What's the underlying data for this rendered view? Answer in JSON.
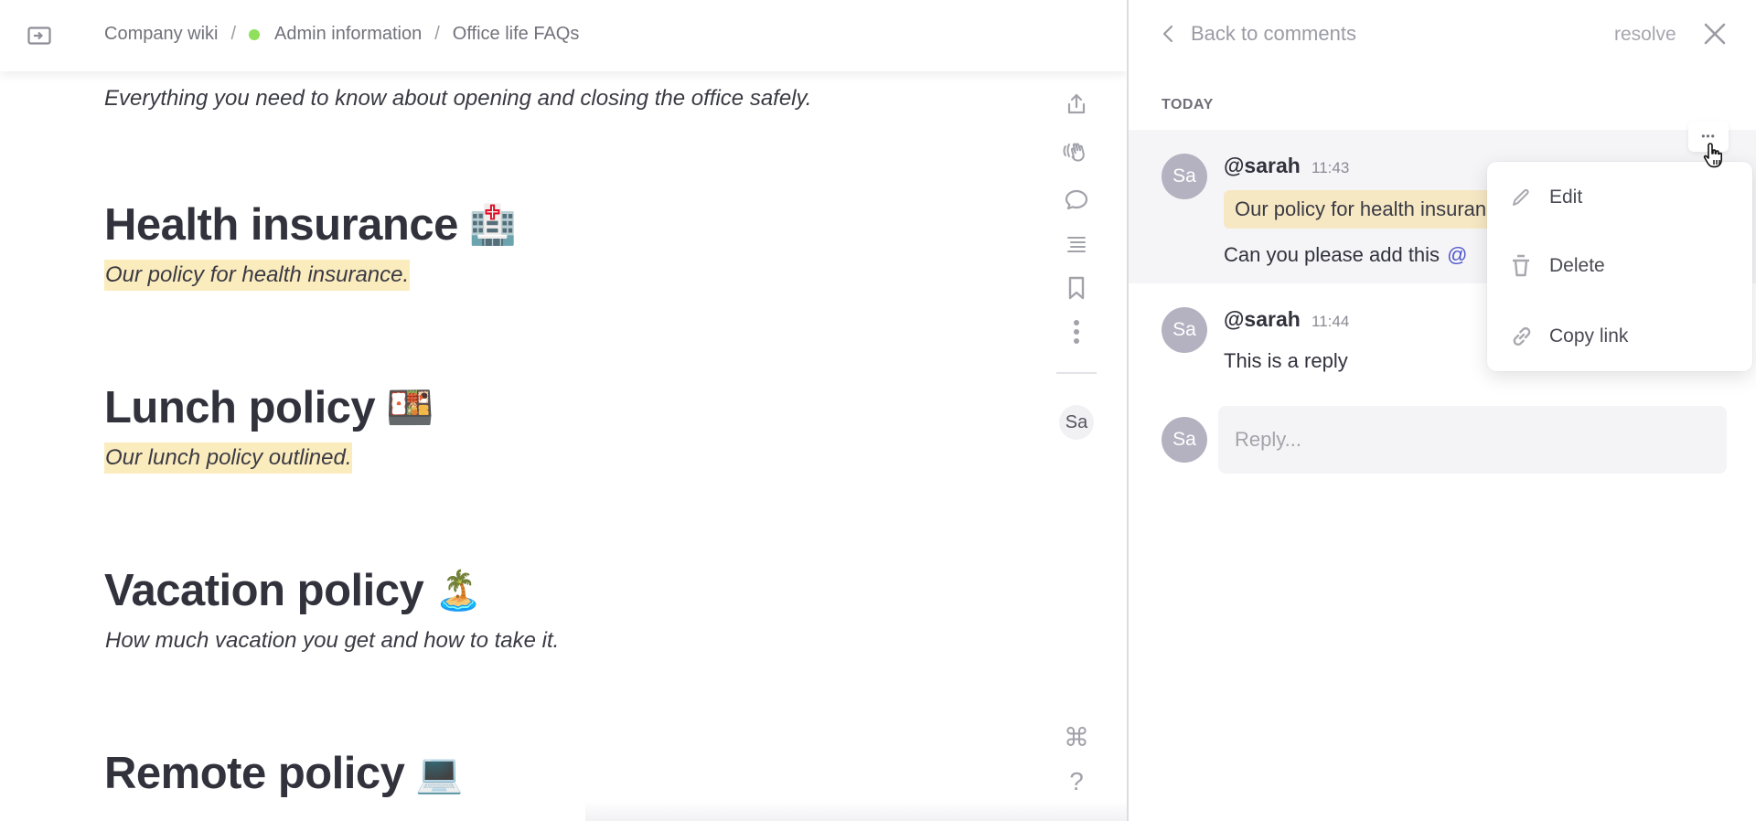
{
  "header": {
    "sidebar_toggle_icon": "sidebar-expand-icon",
    "breadcrumb": [
      {
        "label": "Company wiki"
      },
      {
        "label": "Admin information",
        "dot_color": "#8fe05a"
      },
      {
        "label": "Office life FAQs"
      }
    ],
    "separator": "/"
  },
  "document": {
    "intro": "Everything you need to know about opening and closing the office safely.",
    "sections": [
      {
        "title": "Health insurance",
        "emoji": "🏥",
        "description": "Our policy for health insurance.",
        "highlighted": true
      },
      {
        "title": "Lunch policy",
        "emoji": "🍱",
        "description": "Our lunch policy outlined.",
        "highlighted": true
      },
      {
        "title": "Vacation policy",
        "emoji": "🏝️",
        "description": "How much vacation you get and how to take it.",
        "highlighted": false
      },
      {
        "title": "Remote policy",
        "emoji": "💻",
        "description": "",
        "highlighted": false
      }
    ]
  },
  "rail": {
    "icons": [
      "share-icon",
      "wave-icon",
      "comment-icon",
      "outline-icon",
      "bookmark-icon",
      "more-vertical-icon",
      "command-icon",
      "help-icon"
    ],
    "avatar_initials": "Sa",
    "help_glyph": "?",
    "command_glyph": "⌘"
  },
  "comments_panel": {
    "back_label": "Back to comments",
    "resolve_label": "resolve",
    "day_label": "TODAY",
    "comments": [
      {
        "initials": "Sa",
        "author": "@sarah",
        "time": "11:43",
        "quote": "Our policy for health insurance.",
        "text": "Can you please add this",
        "mention": "@"
      },
      {
        "initials": "Sa",
        "author": "@sarah",
        "time": "11:44",
        "text": "This is a reply"
      }
    ],
    "reply": {
      "initials": "Sa",
      "placeholder": "Reply...",
      "value": ""
    },
    "more_glyph": "•••",
    "context_menu": {
      "items": [
        {
          "label": "Edit",
          "icon": "pencil-icon"
        },
        {
          "label": "Delete",
          "icon": "trash-icon"
        },
        {
          "label": "Copy link",
          "icon": "link-icon"
        }
      ]
    }
  },
  "colors": {
    "highlight": "#fbecbd",
    "quote_bg": "#f7e8c4",
    "mention": "#4d55c9",
    "avatar": "#b4b2c0",
    "active_comment_bg": "#f5f5f8"
  }
}
